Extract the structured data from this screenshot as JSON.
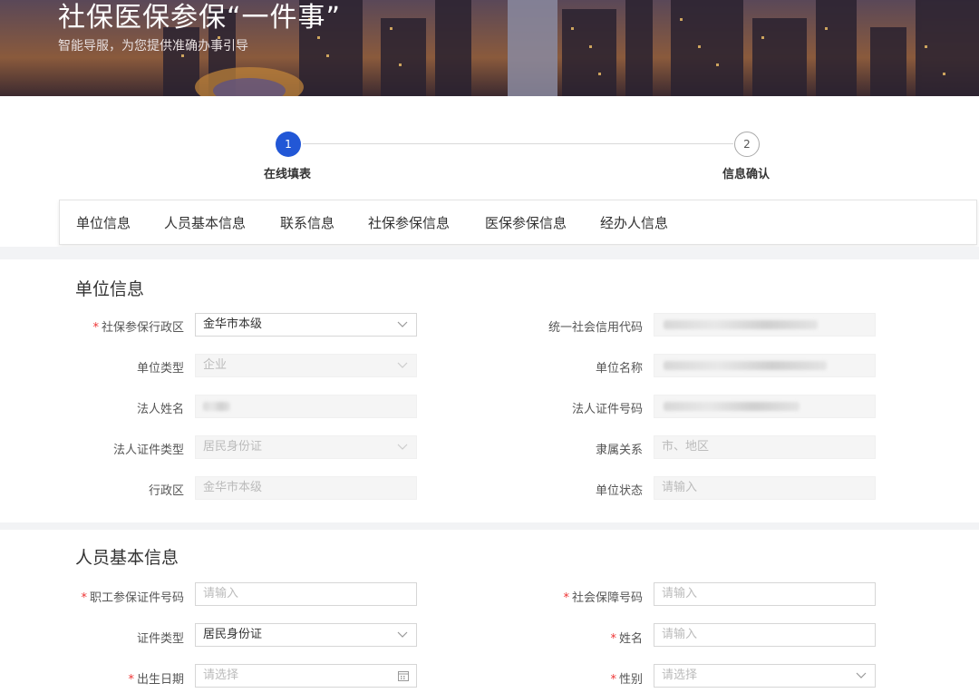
{
  "banner": {
    "title": "社保医保参保“一件事”",
    "subtitle": "智能导服，为您提供准确办事引导"
  },
  "steps": [
    {
      "number": "1",
      "label": "在线填表",
      "state": "active"
    },
    {
      "number": "2",
      "label": "信息确认",
      "state": "todo"
    }
  ],
  "tabs": [
    "单位信息",
    "人员基本信息",
    "联系信息",
    "社保参保信息",
    "医保参保信息",
    "经办人信息"
  ],
  "colors": {
    "accent": "#2257d6",
    "required": "#e33333"
  },
  "unit_section": {
    "title": "单位信息",
    "fields": [
      {
        "label": "社保参保行政区",
        "required": true,
        "value": "金华市本级",
        "kind": "select"
      },
      {
        "label": "统一社会信用代码",
        "required": false,
        "value": "",
        "kind": "redacted"
      },
      {
        "label": "单位类型",
        "required": false,
        "value": "企业",
        "kind": "select-disabled"
      },
      {
        "label": "单位名称",
        "required": false,
        "value": "",
        "kind": "redacted"
      },
      {
        "label": "法人姓名",
        "required": false,
        "value": "",
        "kind": "redacted"
      },
      {
        "label": "法人证件号码",
        "required": false,
        "value": "",
        "kind": "redacted"
      },
      {
        "label": "法人证件类型",
        "required": false,
        "value": "居民身份证",
        "kind": "select-disabled"
      },
      {
        "label": "隶属关系",
        "required": false,
        "value": "市、地区",
        "kind": "disabled"
      },
      {
        "label": "行政区",
        "required": false,
        "value": "金华市本级",
        "kind": "disabled"
      },
      {
        "label": "单位状态",
        "required": false,
        "value": "请输入",
        "kind": "disabled"
      }
    ]
  },
  "person_section": {
    "title": "人员基本信息",
    "fields": [
      {
        "label": "职工参保证件号码",
        "required": true,
        "placeholder": "请输入",
        "kind": "input"
      },
      {
        "label": "社会保障号码",
        "required": true,
        "placeholder": "请输入",
        "kind": "input"
      },
      {
        "label": "证件类型",
        "required": false,
        "value": "居民身份证",
        "kind": "select"
      },
      {
        "label": "姓名",
        "required": true,
        "placeholder": "请输入",
        "kind": "input"
      },
      {
        "label": "出生日期",
        "required": true,
        "placeholder": "请选择",
        "kind": "date"
      },
      {
        "label": "性别",
        "required": true,
        "placeholder": "请选择",
        "kind": "select"
      }
    ]
  },
  "icons": {
    "dropdown": "chevron-down-icon",
    "date": "calendar-icon"
  }
}
